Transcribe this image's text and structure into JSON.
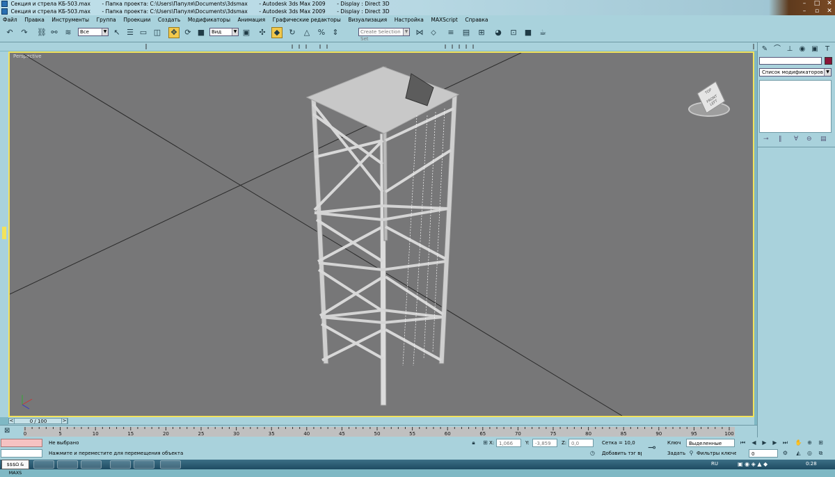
{
  "titlebars": [
    {
      "file": "Секция и стрела КБ-503.max",
      "project": "- Папка проекта: C:\\Users\\Папуля\\Documents\\3dsmax",
      "app": "- Autodesk 3ds Max  2009",
      "display": "- Display : Direct 3D"
    },
    {
      "file": "Секция и стрела КБ-503.max",
      "project": "- Папка проекта: C:\\Users\\Папуля\\Documents\\3dsmax",
      "app": "- Autodesk 3ds Max  2009",
      "display": "- Display : Direct 3D"
    }
  ],
  "menu": [
    "Файл",
    "Правка",
    "Инструменты",
    "Группа",
    "Проекции",
    "Создать",
    "Модификаторы",
    "Анимация",
    "Графические редакторы",
    "Визуализация",
    "Настройка",
    "MAXScript",
    "Справка"
  ],
  "toolbar": {
    "filter_value": "Все",
    "refcoord_value": "Вид",
    "selection_set_placeholder": "Create Selection Set"
  },
  "viewport": {
    "label": "Perspective",
    "viewcube_front": "FRONT",
    "viewcube_left": "LEFT",
    "viewcube_top": "TOP"
  },
  "command_panel": {
    "modifier_list": "Список модификаторов",
    "color": "#8a1538"
  },
  "timeslider": {
    "label": "0 / 100",
    "prev": "<",
    "next": ">"
  },
  "track": {
    "ticks": [
      "0",
      "5",
      "10",
      "15",
      "20",
      "25",
      "30",
      "35",
      "40",
      "45",
      "50",
      "55",
      "60",
      "65",
      "70",
      "75",
      "80",
      "85",
      "90",
      "95",
      "100"
    ]
  },
  "status": {
    "script_listener": "",
    "selection": "Не выбрано",
    "prompt": "Нажмите и переместите для перемещения объекта",
    "x_label": "X:",
    "x_value": "1,066",
    "y_label": "Y:",
    "y_value": "-3,859",
    "z_label": "Z:",
    "z_value": "0,0",
    "grid": "Сетка = 10,0",
    "add_tag": "Добавить тэг време",
    "key_label": "Ключ",
    "set_label": "Задать",
    "keymode_value": "Выделенные",
    "key_filters": "Фильтры ключей",
    "frame_value": "0"
  },
  "taskbar": {
    "start_text": "$$$Ω & MAXS",
    "lang": "RU",
    "time": "0:28"
  }
}
